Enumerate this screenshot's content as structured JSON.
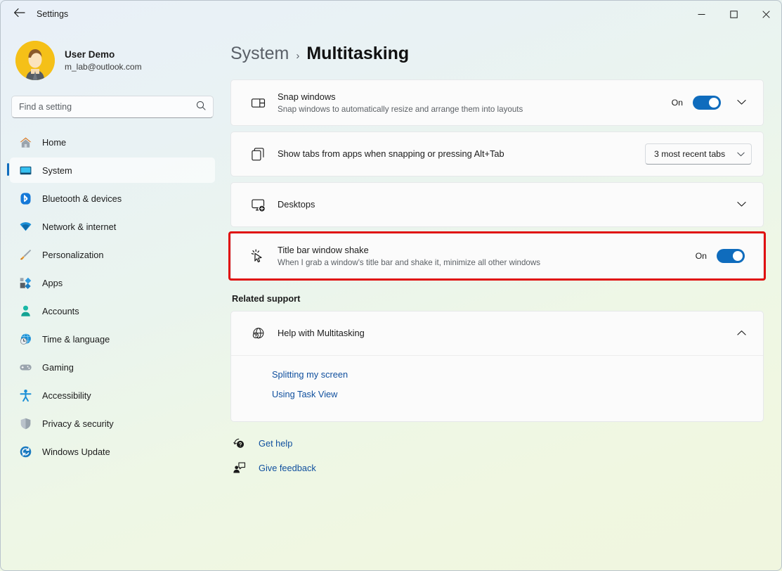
{
  "window": {
    "title": "Settings",
    "back_icon": "back-arrow-icon",
    "controls": {
      "minimize": "minimize-icon",
      "maximize": "maximize-icon",
      "close": "close-icon"
    }
  },
  "sidebar": {
    "account": {
      "name": "User Demo",
      "email": "m_lab@outlook.com",
      "avatar": "user-avatar"
    },
    "search": {
      "placeholder": "Find a setting",
      "value": "",
      "icon": "search-icon"
    },
    "items": [
      {
        "label": "Home",
        "icon": "home-icon",
        "active": false
      },
      {
        "label": "System",
        "icon": "system-monitor-icon",
        "active": true
      },
      {
        "label": "Bluetooth & devices",
        "icon": "bluetooth-icon",
        "active": false
      },
      {
        "label": "Network & internet",
        "icon": "wifi-icon",
        "active": false
      },
      {
        "label": "Personalization",
        "icon": "paintbrush-icon",
        "active": false
      },
      {
        "label": "Apps",
        "icon": "apps-icon",
        "active": false
      },
      {
        "label": "Accounts",
        "icon": "person-icon",
        "active": false
      },
      {
        "label": "Time & language",
        "icon": "clock-globe-icon",
        "active": false
      },
      {
        "label": "Gaming",
        "icon": "gamepad-icon",
        "active": false
      },
      {
        "label": "Accessibility",
        "icon": "accessibility-icon",
        "active": false
      },
      {
        "label": "Privacy & security",
        "icon": "shield-icon",
        "active": false
      },
      {
        "label": "Windows Update",
        "icon": "update-refresh-icon",
        "active": false
      }
    ]
  },
  "main": {
    "breadcrumb": {
      "parent": "System",
      "separator": "›",
      "current": "Multitasking"
    },
    "settings": [
      {
        "title": "Snap windows",
        "subtitle": "Snap windows to automatically resize and arrange them into layouts",
        "icon": "snap-windows-icon",
        "toggle_label": "On",
        "toggle_state": "on",
        "expand_icon": "chevron-down-icon"
      },
      {
        "title": "Show tabs from apps when snapping or pressing Alt+Tab",
        "subtitle": "",
        "icon": "tabs-icon",
        "dropdown_value": "3 most recent tabs",
        "dropdown_icon": "chevron-down-icon"
      },
      {
        "title": "Desktops",
        "subtitle": "",
        "icon": "desktops-add-icon",
        "expand_icon": "chevron-down-icon"
      },
      {
        "title": "Title bar window shake",
        "subtitle": "When I grab a window's title bar and shake it, minimize all other windows",
        "icon": "cursor-shake-icon",
        "toggle_label": "On",
        "toggle_state": "on",
        "highlighted": true,
        "highlight_color": "#e01010"
      }
    ],
    "related_support": {
      "heading": "Related support",
      "expander": {
        "label": "Help with Multitasking",
        "icon": "help-globe-icon",
        "collapse_icon": "chevron-up-icon",
        "expanded": true
      },
      "links": [
        "Splitting my screen",
        "Using Task View"
      ]
    },
    "footer_links": [
      {
        "label": "Get help",
        "icon": "get-help-icon"
      },
      {
        "label": "Give feedback",
        "icon": "give-feedback-icon"
      }
    ]
  },
  "colors": {
    "accent": "#0f6cbd",
    "link": "#0f4f9e",
    "highlight": "#e01010",
    "card_bg": "#fbfbfb"
  }
}
